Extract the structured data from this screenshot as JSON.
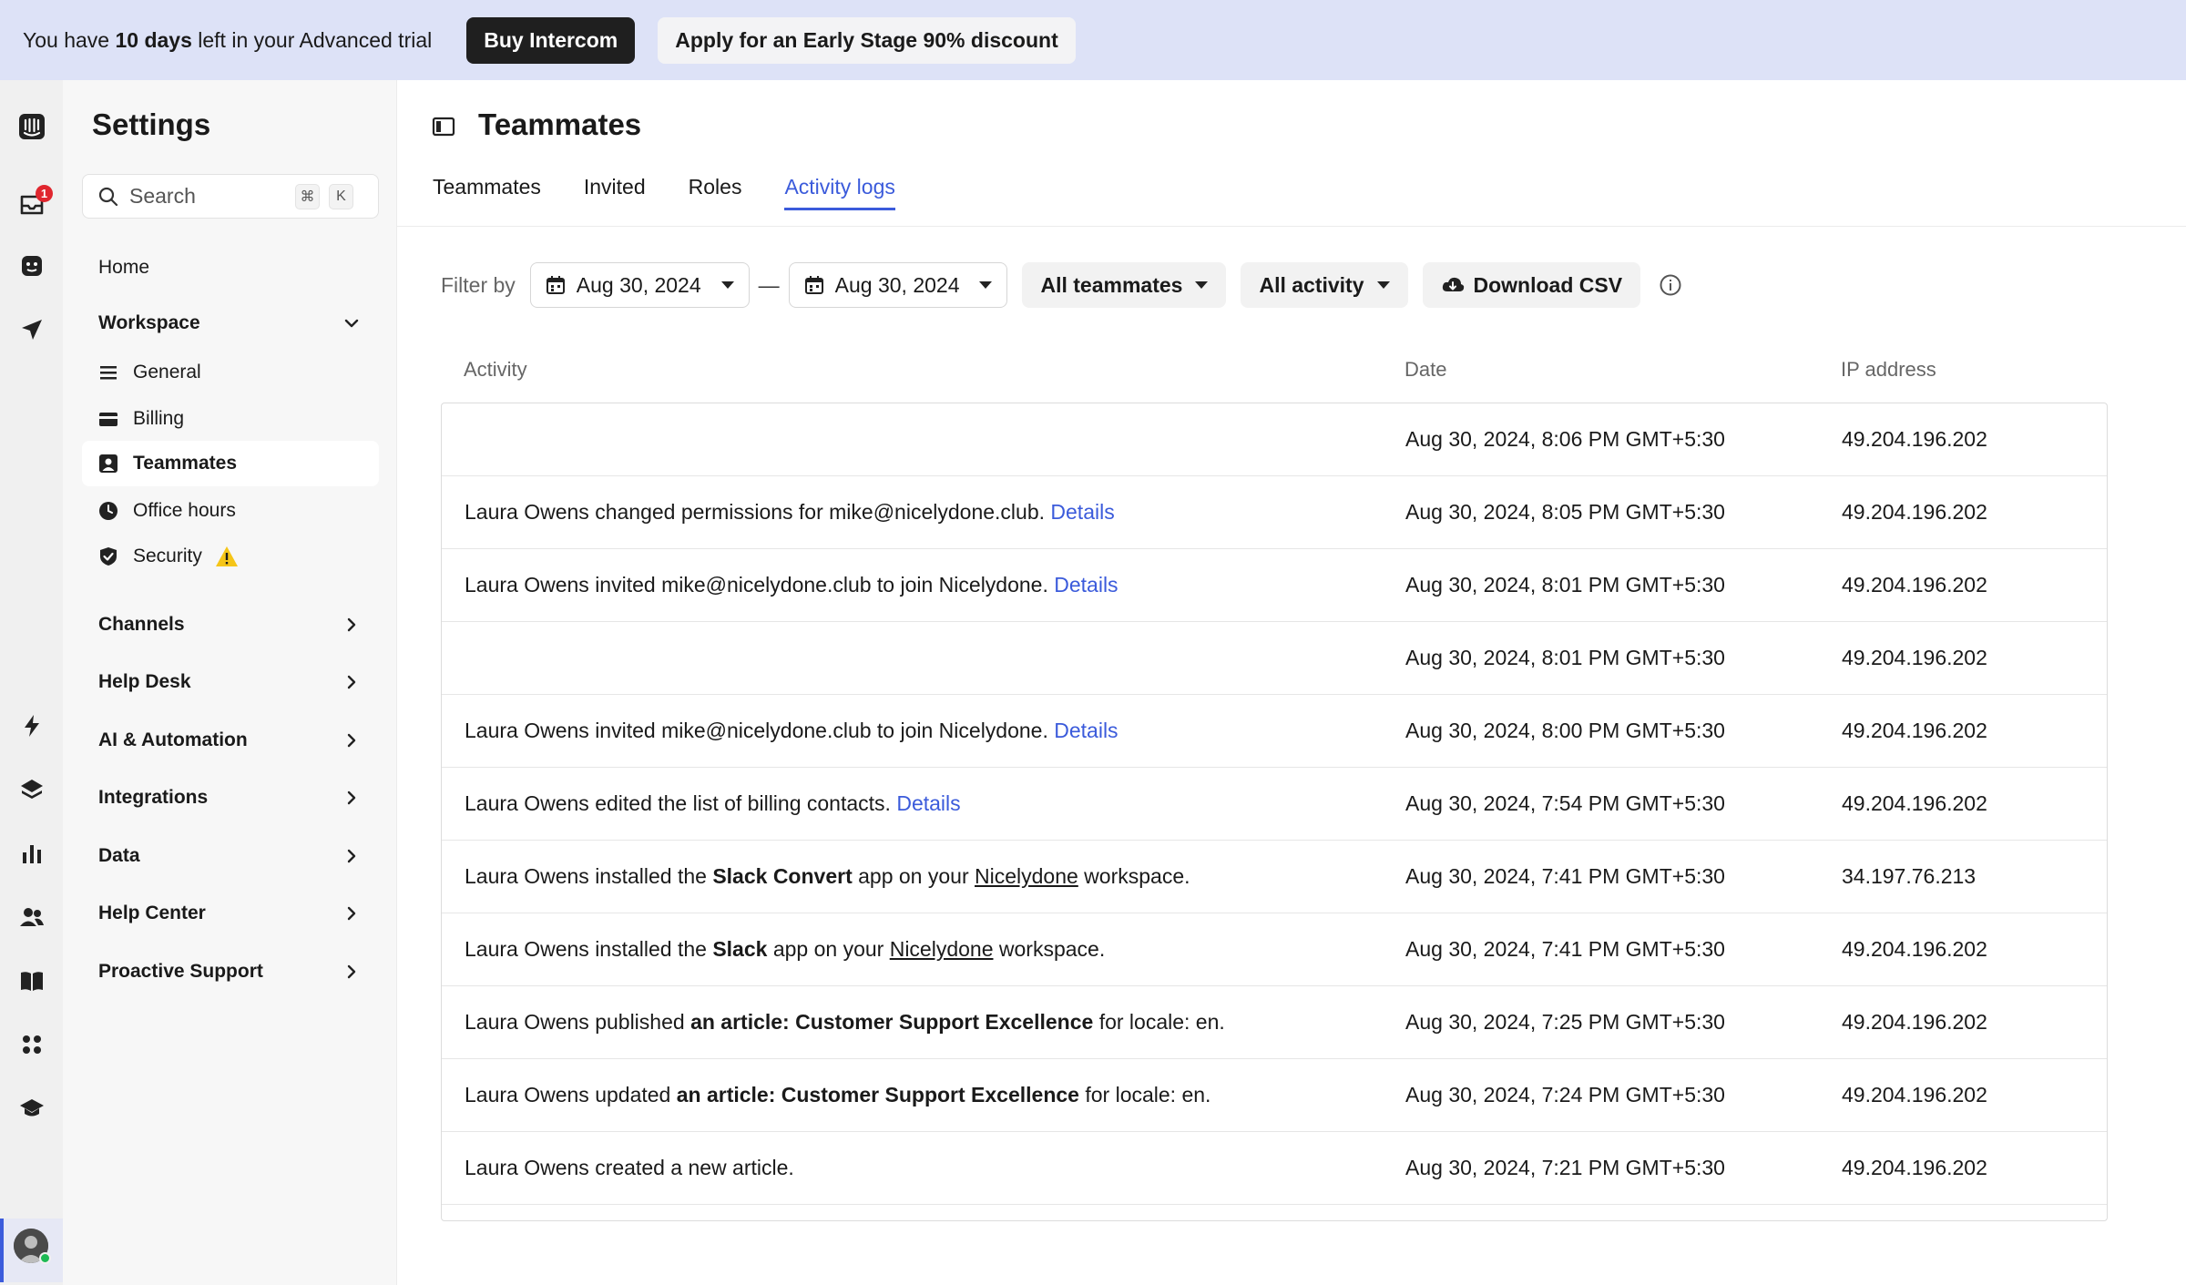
{
  "banner": {
    "text_prefix": "You have ",
    "text_bold": "10 days",
    "text_suffix": " left in your Advanced trial",
    "buy_label": "Buy Intercom",
    "discount_label": "Apply for an Early Stage 90% discount"
  },
  "rail": {
    "inbox_badge": "1"
  },
  "sidebar": {
    "title": "Settings",
    "search_placeholder": "Search",
    "shortcut_keys": [
      "⌘",
      "K"
    ],
    "home": "Home",
    "workspace": "Workspace",
    "workspace_items": [
      {
        "label": "General",
        "icon": "list-icon"
      },
      {
        "label": "Billing",
        "icon": "card-icon"
      },
      {
        "label": "Teammates",
        "icon": "person-icon",
        "active": true
      },
      {
        "label": "Office hours",
        "icon": "clock-icon"
      },
      {
        "label": "Security",
        "icon": "shield-icon",
        "warning": true
      }
    ],
    "sections": [
      "Channels",
      "Help Desk",
      "AI & Automation",
      "Integrations",
      "Data",
      "Help Center",
      "Proactive Support"
    ]
  },
  "main": {
    "title": "Teammates",
    "tabs": [
      "Teammates",
      "Invited",
      "Roles",
      "Activity logs"
    ],
    "active_tab": "Activity logs",
    "filter": {
      "label": "Filter by",
      "start_date": "Aug 30, 2024",
      "separator": "—",
      "end_date": "Aug 30, 2024",
      "teammates": "All teammates",
      "activity": "All activity",
      "download": "Download CSV"
    },
    "columns": [
      "Activity",
      "Date",
      "IP address"
    ],
    "rows": [
      {
        "date": "Aug 30, 2024, 8:06 PM GMT+5:30",
        "ip": "49.204.196.202"
      },
      {
        "pre": "Laura Owens changed permissions for mike@nicelydone.club. ",
        "details": "Details",
        "date": "Aug 30, 2024, 8:05 PM GMT+5:30",
        "ip": "49.204.196.202"
      },
      {
        "pre": "Laura Owens invited mike@nicelydone.club to join Nicelydone. ",
        "details": "Details",
        "date": "Aug 30, 2024, 8:01 PM GMT+5:30",
        "ip": "49.204.196.202"
      },
      {
        "date": "Aug 30, 2024, 8:01 PM GMT+5:30",
        "ip": "49.204.196.202"
      },
      {
        "pre": "Laura Owens invited mike@nicelydone.club to join Nicelydone. ",
        "details": "Details",
        "date": "Aug 30, 2024, 8:00 PM GMT+5:30",
        "ip": "49.204.196.202"
      },
      {
        "pre": "Laura Owens edited the list of billing contacts. ",
        "details": "Details",
        "date": "Aug 30, 2024, 7:54 PM GMT+5:30",
        "ip": "49.204.196.202"
      },
      {
        "pre": "Laura Owens installed the ",
        "strong": "Slack Convert",
        "mid": " app on your ",
        "link": "Nicelydone",
        "post": " workspace.",
        "date": "Aug 30, 2024, 7:41 PM GMT+5:30",
        "ip": "34.197.76.213"
      },
      {
        "pre": "Laura Owens installed the ",
        "strong": "Slack",
        "mid": " app on your ",
        "link": "Nicelydone",
        "post": " workspace.",
        "date": "Aug 30, 2024, 7:41 PM GMT+5:30",
        "ip": "49.204.196.202"
      },
      {
        "pre": "Laura Owens published ",
        "strong": "an article: Customer Support Excellence",
        "mid": " for locale: en.",
        "date": "Aug 30, 2024, 7:25 PM GMT+5:30",
        "ip": "49.204.196.202"
      },
      {
        "pre": "Laura Owens updated ",
        "strong": "an article: Customer Support Excellence",
        "mid": " for locale: en.",
        "date": "Aug 30, 2024, 7:24 PM GMT+5:30",
        "ip": "49.204.196.202"
      },
      {
        "pre": "Laura Owens created a new article.",
        "date": "Aug 30, 2024, 7:21 PM GMT+5:30",
        "ip": "49.204.196.202"
      }
    ]
  },
  "colors": {
    "accent": "#3b5bdb",
    "banner_bg": "#dde2f7",
    "warning": "#f5c518",
    "badge": "#e0262e"
  }
}
